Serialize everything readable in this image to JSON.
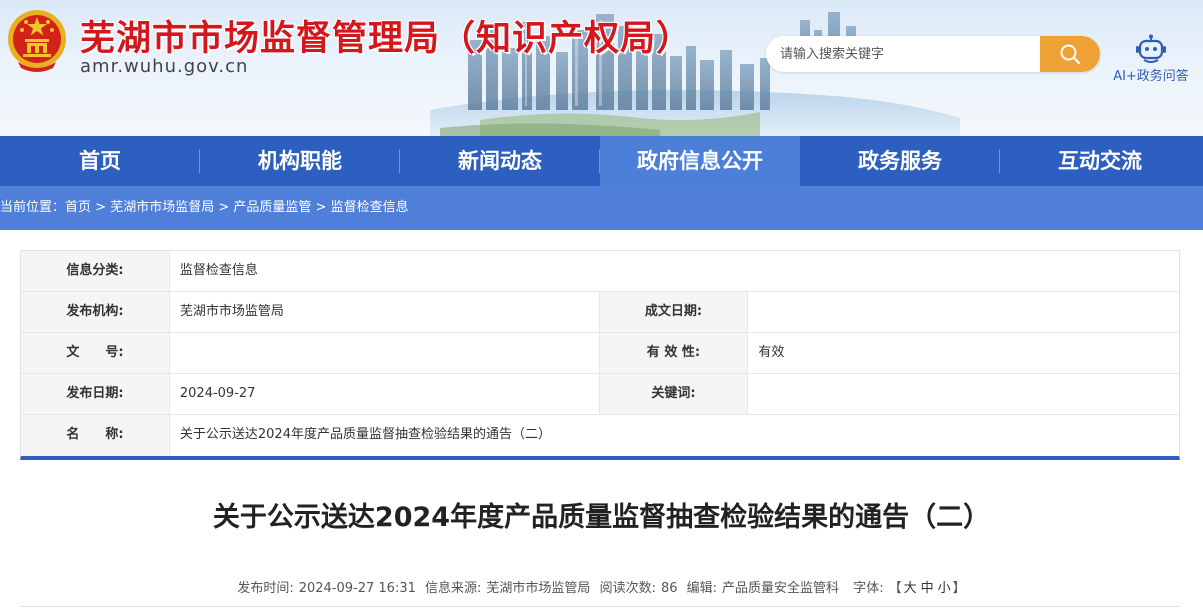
{
  "header": {
    "title": "芜湖市市场监督管理局（知识产权局）",
    "domain": "amr.wuhu.gov.cn",
    "search_placeholder": "请输入搜索关键字",
    "ai_label": "AI+政务问答"
  },
  "nav": {
    "items": [
      "首页",
      "机构职能",
      "新闻动态",
      "政府信息公开",
      "政务服务",
      "互动交流"
    ],
    "active_index": 3
  },
  "breadcrumb": {
    "prefix": "当前位置：",
    "separator": " > ",
    "items": [
      "首页",
      "芜湖市市场监督局",
      "产品质量监管",
      "监督检查信息"
    ]
  },
  "info": {
    "category_label": "信息分类:",
    "category_value": "监督检查信息",
    "publisher_label": "发布机构:",
    "publisher_value": "芜湖市市场监管局",
    "created_label": "成文日期:",
    "created_value": "",
    "doc_no_label": "文　　号:",
    "doc_no_value": "",
    "validity_label": "有 效 性:",
    "validity_value": "有效",
    "pub_date_label": "发布日期:",
    "pub_date_value": "2024-09-27",
    "keywords_label": "关键词:",
    "keywords_value": "",
    "name_label": "名　　称:",
    "name_value": "关于公示送达2024年度产品质量监督抽查检验结果的通告（二）"
  },
  "article": {
    "title": "关于公示送达2024年度产品质量监督抽查检验结果的通告（二）",
    "publish_time_label": "发布时间:",
    "publish_time": "2024-09-27 16:31",
    "source_label": "信息来源:",
    "source": "芜湖市市场监管局",
    "views_label": "阅读次数:",
    "views": "86",
    "editor_label": "编辑:",
    "editor": "产品质量安全监管科",
    "font_label": "字体:",
    "font_open": "【",
    "font_large": "大",
    "font_medium": "中",
    "font_small": "小",
    "font_close": "】"
  },
  "colors": {
    "title_red": "#d4161d",
    "nav_blue": "#2c5fbf",
    "nav_active": "#4c7fd8",
    "breadcrumb_blue": "#4f7fd9",
    "search_orange": "#eea236"
  },
  "icons": {
    "emblem": "national-emblem-icon",
    "search": "search-icon",
    "ai": "robot-icon"
  }
}
